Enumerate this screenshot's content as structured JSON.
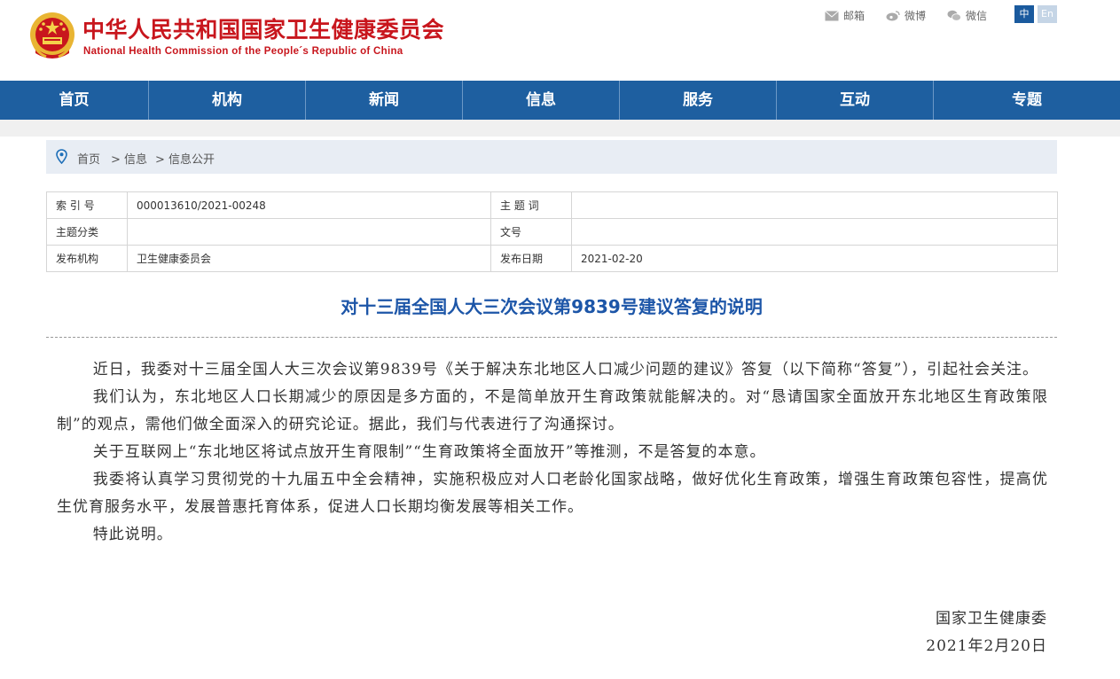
{
  "header": {
    "title_cn": "中华人民共和国国家卫生健康委员会",
    "title_en": "National Health Commission of the People´s Republic of China",
    "links": [
      {
        "label": "邮箱",
        "icon": "mail-icon"
      },
      {
        "label": "微博",
        "icon": "weibo-icon"
      },
      {
        "label": "微信",
        "icon": "wechat-icon"
      }
    ],
    "lang_zh": "中",
    "lang_en": "En"
  },
  "nav": [
    "首页",
    "机构",
    "新闻",
    "信息",
    "服务",
    "互动",
    "专题"
  ],
  "breadcrumb": {
    "home": "首页",
    "level1": "> 信息",
    "level2": "> 信息公开"
  },
  "meta": {
    "index_label": "索 引 号",
    "index_value": "000013610/2021-00248",
    "keyword_label": "主 题 词",
    "keyword_value": "",
    "category_label": "主题分类",
    "category_value": "",
    "docno_label": "文号",
    "docno_value": "",
    "publisher_label": "发布机构",
    "publisher_value": "卫生健康委员会",
    "date_label": "发布日期",
    "date_value": "2021-02-20"
  },
  "article": {
    "title": "对十三届全国人大三次会议第9839号建议答复的说明",
    "paragraphs": [
      "近日，我委对十三届全国人大三次会议第9839号《关于解决东北地区人口减少问题的建议》答复（以下简称“答复”），引起社会关注。",
      "我们认为，东北地区人口长期减少的原因是多方面的，不是简单放开生育政策就能解决的。对“恳请国家全面放开东北地区生育政策限制”的观点，需他们做全面深入的研究论证。据此，我们与代表进行了沟通探讨。",
      "关于互联网上“东北地区将试点放开生育限制”“生育政策将全面放开”等推测，不是答复的本意。",
      "我委将认真学习贯彻党的十九届五中全会精神，实施积极应对人口老龄化国家战略，做好优化生育政策，增强生育政策包容性，提高优生优育服务水平，发展普惠托育体系，促进人口长期均衡发展等相关工作。",
      "特此说明。"
    ],
    "signature": "国家卫生健康委",
    "date": "2021年2月20日"
  },
  "colors": {
    "brand_red": "#c8161d",
    "nav_blue": "#1e5fa0",
    "title_blue": "#1d56a8"
  }
}
